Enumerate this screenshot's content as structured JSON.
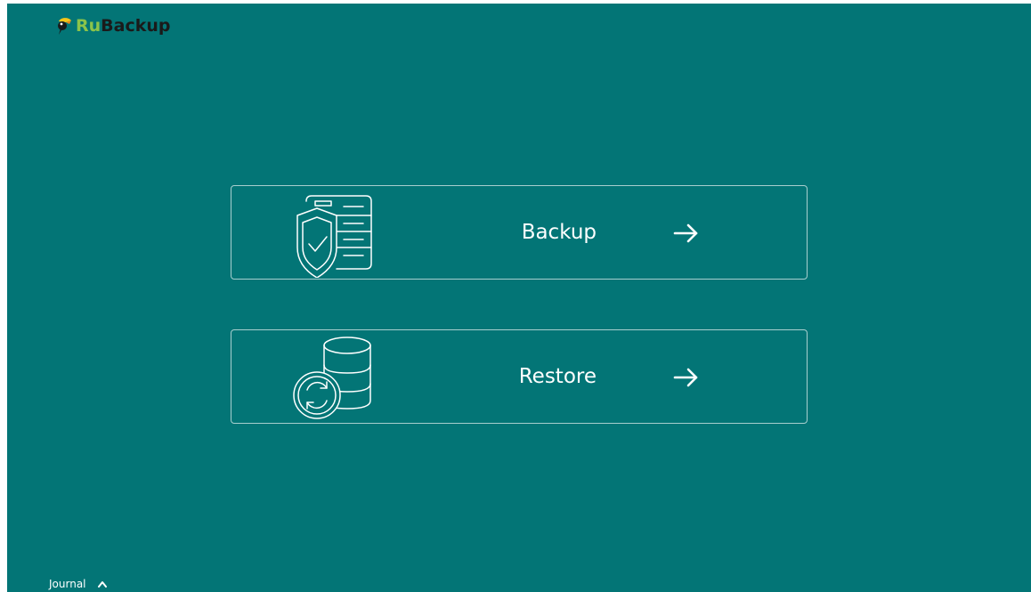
{
  "brand": {
    "prefix": "Ru",
    "suffix": "Backup",
    "icon": "toucan-logo"
  },
  "actions": {
    "backup": {
      "label": "Backup",
      "icon": "document-shield-check-icon",
      "arrow": "arrow-right-icon"
    },
    "restore": {
      "label": "Restore",
      "icon": "database-restore-icon",
      "arrow": "arrow-right-icon"
    }
  },
  "footer": {
    "journal_label": "Journal",
    "toggle_icon": "chevron-up-icon"
  },
  "colors": {
    "background": "#037576",
    "card_border": "#a8cfcf",
    "text": "#ffffff",
    "brand_green": "#8bc34a",
    "brand_dark": "#1a1a1a"
  }
}
